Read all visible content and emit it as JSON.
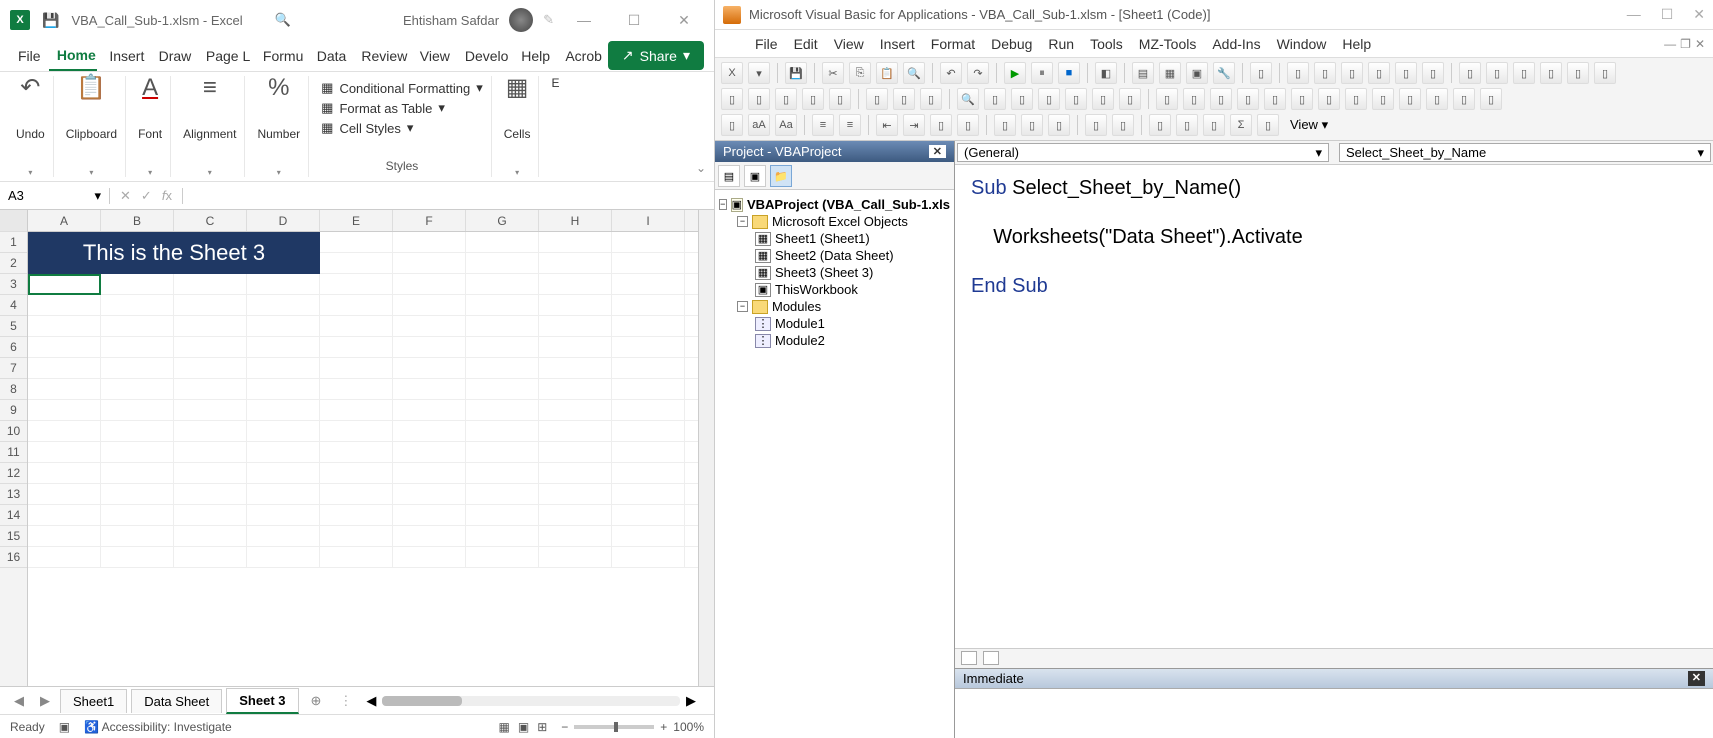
{
  "excel": {
    "title": "VBA_Call_Sub-1.xlsm  -  Excel",
    "user": "Ehtisham Safdar",
    "ribbon_tabs": [
      "File",
      "Home",
      "Insert",
      "Draw",
      "Page L",
      "Formu",
      "Data",
      "Review",
      "View",
      "Develo",
      "Help",
      "Acrob"
    ],
    "active_tab": "Home",
    "share": "Share",
    "groups": {
      "undo": "Undo",
      "clipboard": "Clipboard",
      "font": "Font",
      "alignment": "Alignment",
      "number": "Number",
      "cells": "Cells",
      "editing": "E"
    },
    "styles": {
      "cond": "Conditional Formatting",
      "table": "Format as Table",
      "cell": "Cell Styles",
      "label": "Styles"
    },
    "name_box": "A3",
    "merged_text": "This is the Sheet 3",
    "columns": [
      "A",
      "B",
      "C",
      "D",
      "E",
      "F",
      "G",
      "H",
      "I"
    ],
    "rows": [
      "1",
      "2",
      "3",
      "4",
      "5",
      "6",
      "7",
      "8",
      "9",
      "10",
      "11",
      "12",
      "13",
      "14",
      "15",
      "16"
    ],
    "sheet_tabs": [
      "Sheet1",
      "Data Sheet",
      "Sheet 3"
    ],
    "active_sheet": "Sheet 3",
    "status_ready": "Ready",
    "status_access": "Accessibility: Investigate",
    "zoom": "100%"
  },
  "vbe": {
    "title": "Microsoft Visual Basic for Applications - VBA_Call_Sub-1.xlsm - [Sheet1 (Code)]",
    "menus": [
      "File",
      "Edit",
      "View",
      "Insert",
      "Format",
      "Debug",
      "Run",
      "Tools",
      "MZ-Tools",
      "Add-Ins",
      "Window",
      "Help"
    ],
    "toolbar_view": "View",
    "project_title": "Project - VBAProject",
    "tree": {
      "project": "VBAProject (VBA_Call_Sub-1.xls",
      "excel_objects": "Microsoft Excel Objects",
      "sheets": [
        "Sheet1 (Sheet1)",
        "Sheet2 (Data Sheet)",
        "Sheet3 (Sheet 3)",
        "ThisWorkbook"
      ],
      "modules_label": "Modules",
      "modules": [
        "Module1",
        "Module2"
      ]
    },
    "dd_left": "(General)",
    "dd_right": "Select_Sheet_by_Name",
    "code": {
      "l1a": "Sub",
      "l1b": " Select_Sheet_by_Name()",
      "l2": "    Worksheets(\"Data Sheet\").Activate",
      "l3": "End Sub"
    },
    "immediate": "Immediate"
  }
}
